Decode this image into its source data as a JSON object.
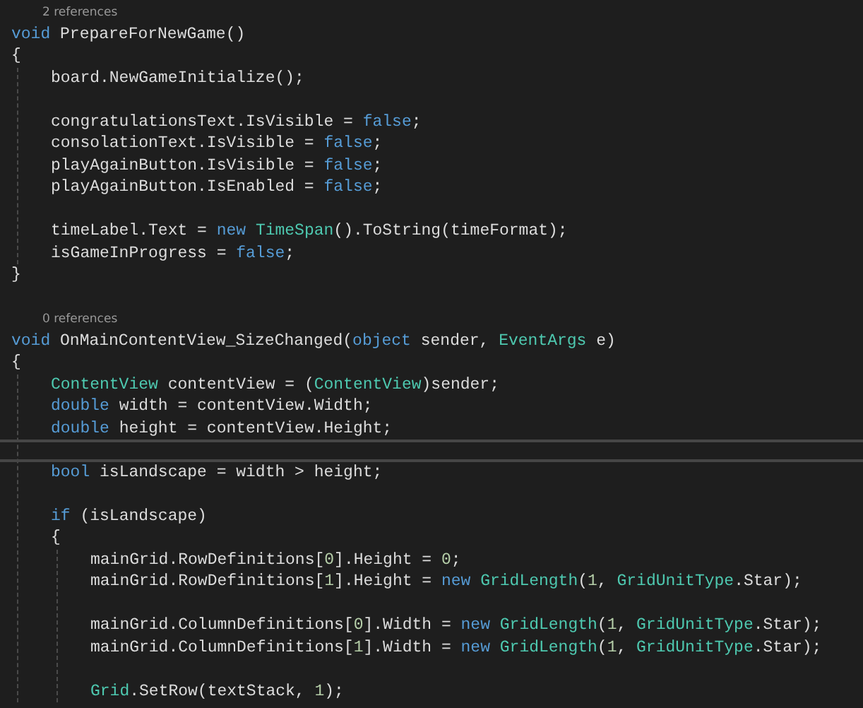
{
  "editor": {
    "lines": [
      {
        "kind": "codelens",
        "current": false,
        "text": "2 references"
      },
      {
        "kind": "code",
        "current": false,
        "tokens": [
          {
            "kind": "keyword",
            "text": "void"
          },
          {
            "kind": "plain",
            "text": " PrepareForNewGame()"
          }
        ]
      },
      {
        "kind": "code",
        "current": false,
        "tokens": [
          {
            "kind": "plain",
            "text": "{"
          }
        ],
        "children": [
          {
            "kind": "code",
            "current": false,
            "tokens": [
              {
                "kind": "plain",
                "text": "board.NewGameInitialize();"
              }
            ]
          },
          {
            "kind": "blank",
            "current": false
          },
          {
            "kind": "code",
            "current": false,
            "tokens": [
              {
                "kind": "plain",
                "text": "congratulationsText.IsVisible = "
              },
              {
                "kind": "keyword",
                "text": "false"
              },
              {
                "kind": "plain",
                "text": ";"
              }
            ]
          },
          {
            "kind": "code",
            "current": false,
            "tokens": [
              {
                "kind": "plain",
                "text": "consolationText.IsVisible = "
              },
              {
                "kind": "keyword",
                "text": "false"
              },
              {
                "kind": "plain",
                "text": ";"
              }
            ]
          },
          {
            "kind": "code",
            "current": false,
            "tokens": [
              {
                "kind": "plain",
                "text": "playAgainButton.IsVisible = "
              },
              {
                "kind": "keyword",
                "text": "false"
              },
              {
                "kind": "plain",
                "text": ";"
              }
            ]
          },
          {
            "kind": "code",
            "current": false,
            "tokens": [
              {
                "kind": "plain",
                "text": "playAgainButton.IsEnabled = "
              },
              {
                "kind": "keyword",
                "text": "false"
              },
              {
                "kind": "plain",
                "text": ";"
              }
            ]
          },
          {
            "kind": "blank",
            "current": false
          },
          {
            "kind": "code",
            "current": false,
            "tokens": [
              {
                "kind": "plain",
                "text": "timeLabel.Text = "
              },
              {
                "kind": "keyword",
                "text": "new"
              },
              {
                "kind": "type",
                "text": " TimeSpan"
              },
              {
                "kind": "plain",
                "text": "().ToString(timeFormat);"
              }
            ]
          },
          {
            "kind": "code",
            "current": false,
            "tokens": [
              {
                "kind": "plain",
                "text": "isGameInProgress = "
              },
              {
                "kind": "keyword",
                "text": "false"
              },
              {
                "kind": "plain",
                "text": ";"
              }
            ]
          }
        ]
      },
      {
        "kind": "code",
        "current": false,
        "tokens": [
          {
            "kind": "plain",
            "text": "}"
          }
        ]
      },
      {
        "kind": "blank",
        "current": false
      },
      {
        "kind": "codelens",
        "current": false,
        "text": "0 references"
      },
      {
        "kind": "code",
        "current": false,
        "tokens": [
          {
            "kind": "keyword",
            "text": "void"
          },
          {
            "kind": "plain",
            "text": " OnMainContentView_SizeChanged("
          },
          {
            "kind": "keyword",
            "text": "object"
          },
          {
            "kind": "plain",
            "text": " sender, "
          },
          {
            "kind": "type",
            "text": "EventArgs"
          },
          {
            "kind": "plain",
            "text": " e)"
          }
        ]
      },
      {
        "kind": "code",
        "current": false,
        "tokens": [
          {
            "kind": "plain",
            "text": "{"
          }
        ],
        "children": [
          {
            "kind": "code",
            "current": false,
            "tokens": [
              {
                "kind": "type",
                "text": "ContentView"
              },
              {
                "kind": "plain",
                "text": " contentView = ("
              },
              {
                "kind": "type",
                "text": "ContentView"
              },
              {
                "kind": "plain",
                "text": ")sender;"
              }
            ]
          },
          {
            "kind": "code",
            "current": false,
            "tokens": [
              {
                "kind": "keyword",
                "text": "double"
              },
              {
                "kind": "plain",
                "text": " width = contentView.Width;"
              }
            ]
          },
          {
            "kind": "code",
            "current": false,
            "tokens": [
              {
                "kind": "keyword",
                "text": "double"
              },
              {
                "kind": "plain",
                "text": " height = contentView.Height;"
              }
            ]
          },
          {
            "kind": "blank",
            "current": true
          },
          {
            "kind": "code",
            "current": false,
            "tokens": [
              {
                "kind": "keyword",
                "text": "bool"
              },
              {
                "kind": "plain",
                "text": " isLandscape = width > height;"
              }
            ]
          },
          {
            "kind": "blank",
            "current": false
          },
          {
            "kind": "code",
            "current": false,
            "tokens": [
              {
                "kind": "keyword",
                "text": "if"
              },
              {
                "kind": "plain",
                "text": " (isLandscape)"
              }
            ]
          },
          {
            "kind": "code",
            "current": false,
            "tokens": [
              {
                "kind": "plain",
                "text": "{"
              }
            ],
            "children": [
              {
                "kind": "code",
                "current": false,
                "tokens": [
                  {
                    "kind": "plain",
                    "text": "mainGrid.RowDefinitions["
                  },
                  {
                    "kind": "number",
                    "text": "0"
                  },
                  {
                    "kind": "plain",
                    "text": "].Height = "
                  },
                  {
                    "kind": "number",
                    "text": "0"
                  },
                  {
                    "kind": "plain",
                    "text": ";"
                  }
                ]
              },
              {
                "kind": "code",
                "current": false,
                "tokens": [
                  {
                    "kind": "plain",
                    "text": "mainGrid.RowDefinitions["
                  },
                  {
                    "kind": "number",
                    "text": "1"
                  },
                  {
                    "kind": "plain",
                    "text": "].Height = "
                  },
                  {
                    "kind": "keyword",
                    "text": "new"
                  },
                  {
                    "kind": "type",
                    "text": " GridLength"
                  },
                  {
                    "kind": "plain",
                    "text": "("
                  },
                  {
                    "kind": "number",
                    "text": "1"
                  },
                  {
                    "kind": "plain",
                    "text": ", "
                  },
                  {
                    "kind": "type",
                    "text": "GridUnitType"
                  },
                  {
                    "kind": "plain",
                    "text": ".Star);"
                  }
                ]
              },
              {
                "kind": "blank",
                "current": false
              },
              {
                "kind": "code",
                "current": false,
                "tokens": [
                  {
                    "kind": "plain",
                    "text": "mainGrid.ColumnDefinitions["
                  },
                  {
                    "kind": "number",
                    "text": "0"
                  },
                  {
                    "kind": "plain",
                    "text": "].Width = "
                  },
                  {
                    "kind": "keyword",
                    "text": "new"
                  },
                  {
                    "kind": "type",
                    "text": " GridLength"
                  },
                  {
                    "kind": "plain",
                    "text": "("
                  },
                  {
                    "kind": "number",
                    "text": "1"
                  },
                  {
                    "kind": "plain",
                    "text": ", "
                  },
                  {
                    "kind": "type",
                    "text": "GridUnitType"
                  },
                  {
                    "kind": "plain",
                    "text": ".Star);"
                  }
                ]
              },
              {
                "kind": "code",
                "current": false,
                "tokens": [
                  {
                    "kind": "plain",
                    "text": "mainGrid.ColumnDefinitions["
                  },
                  {
                    "kind": "number",
                    "text": "1"
                  },
                  {
                    "kind": "plain",
                    "text": "].Width = "
                  },
                  {
                    "kind": "keyword",
                    "text": "new"
                  },
                  {
                    "kind": "type",
                    "text": " GridLength"
                  },
                  {
                    "kind": "plain",
                    "text": "("
                  },
                  {
                    "kind": "number",
                    "text": "1"
                  },
                  {
                    "kind": "plain",
                    "text": ", "
                  },
                  {
                    "kind": "type",
                    "text": "GridUnitType"
                  },
                  {
                    "kind": "plain",
                    "text": ".Star);"
                  }
                ]
              },
              {
                "kind": "blank",
                "current": false
              },
              {
                "kind": "code",
                "current": false,
                "tokens": [
                  {
                    "kind": "type",
                    "text": "Grid"
                  },
                  {
                    "kind": "plain",
                    "text": ".SetRow(textStack, "
                  },
                  {
                    "kind": "number",
                    "text": "1"
                  },
                  {
                    "kind": "plain",
                    "text": ");"
                  }
                ]
              }
            ]
          }
        ]
      }
    ]
  }
}
